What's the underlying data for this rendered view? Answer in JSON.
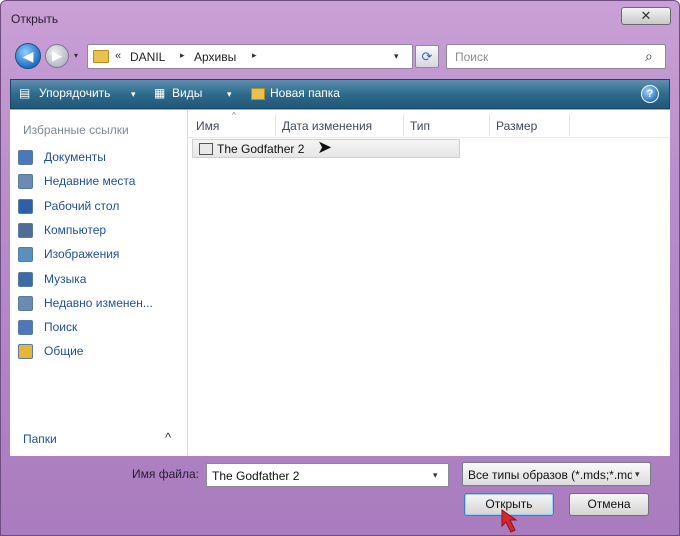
{
  "window": {
    "title": "Открыть",
    "close_glyph": "✕"
  },
  "nav": {
    "back_glyph": "◀",
    "forward_glyph": "▶",
    "recent_glyph": "▾"
  },
  "address": {
    "chevron": "«",
    "segments": [
      "DANIL",
      "Архивы"
    ],
    "separator_glyph": "▸",
    "dropdown_glyph": "▾",
    "refresh_glyph": "⟳"
  },
  "search": {
    "placeholder": "Поиск",
    "icon_glyph": "⌕"
  },
  "toolbar": {
    "organize_label": "Упорядочить",
    "views_label": "Виды",
    "new_folder_label": "Новая папка",
    "dropdown_glyph": "▾",
    "help_glyph": "?"
  },
  "sidebar": {
    "heading": "Избранные ссылки",
    "items": [
      {
        "label": "Документы",
        "icon": "documents-icon",
        "color": "#4a78b8"
      },
      {
        "label": "Недавние места",
        "icon": "recent-places-icon",
        "color": "#6b8bb0"
      },
      {
        "label": "Рабочий стол",
        "icon": "desktop-icon",
        "color": "#2f5fa8"
      },
      {
        "label": "Компьютер",
        "icon": "computer-icon",
        "color": "#4e6e94"
      },
      {
        "label": "Изображения",
        "icon": "pictures-icon",
        "color": "#5a8fc0"
      },
      {
        "label": "Музыка",
        "icon": "music-icon",
        "color": "#3a6aa8"
      },
      {
        "label": "Недавно изменен...",
        "icon": "recently-changed-icon",
        "color": "#6b8bb0"
      },
      {
        "label": "Поиск",
        "icon": "search-folder-icon",
        "color": "#4a78b8"
      },
      {
        "label": "Общие",
        "icon": "public-folder-icon",
        "color": "#e2b73c"
      }
    ],
    "folders_label": "Папки",
    "folders_chevron": "^"
  },
  "file_list": {
    "columns": [
      "Имя",
      "Дата изменения",
      "Тип",
      "Размер"
    ],
    "sort_glyph": "^",
    "files": [
      {
        "name": "The Godfather 2",
        "icon": "disc-image-file-icon"
      }
    ]
  },
  "footer": {
    "filename_label": "Имя файла:",
    "filename_value": "The Godfather 2",
    "filter_value": "Все типы образов (*.mds;*.md",
    "dropdown_glyph": "▾",
    "open_label": "Открыть",
    "cancel_label": "Отмена"
  },
  "colors": {
    "toolbar": "#2f6a8c",
    "window_frame": "#b88bc9",
    "link_text": "#1f4f9c",
    "annotation_arrow": "#d9272e"
  }
}
